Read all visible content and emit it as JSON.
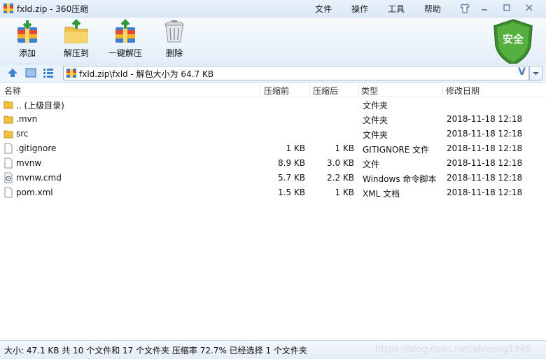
{
  "window": {
    "title": "fxld.zip - 360压缩",
    "menu": [
      "文件",
      "操作",
      "工具",
      "帮助"
    ]
  },
  "toolbar": {
    "items": [
      {
        "label": "添加",
        "icon": "add-archive-icon"
      },
      {
        "label": "解压到",
        "icon": "extract-to-folder-icon"
      },
      {
        "label": "一键解压",
        "icon": "one-click-extract-icon"
      },
      {
        "label": "删除",
        "icon": "trash-can-icon"
      }
    ],
    "safe_label": "安全"
  },
  "address": {
    "path": "fxld.zip\\fxld - 解包大小为 64.7 KB",
    "v_label": "V"
  },
  "columns": [
    "名称",
    "压缩前",
    "压缩后",
    "类型",
    "修改日期"
  ],
  "files": [
    {
      "name": ".. (上级目录)",
      "before": "",
      "after": "",
      "type": "文件夹",
      "date": "",
      "icon": "folder-icon"
    },
    {
      "name": ".mvn",
      "before": "",
      "after": "",
      "type": "文件夹",
      "date": "2018-11-18 12:18",
      "icon": "folder-icon"
    },
    {
      "name": "src",
      "before": "",
      "after": "",
      "type": "文件夹",
      "date": "2018-11-18 12:18",
      "icon": "folder-icon"
    },
    {
      "name": ".gitignore",
      "before": "1 KB",
      "after": "1 KB",
      "type": "GITIGNORE 文件",
      "date": "2018-11-18 12:18",
      "icon": "file-icon"
    },
    {
      "name": "mvnw",
      "before": "8.9 KB",
      "after": "3.0 KB",
      "type": "文件",
      "date": "2018-11-18 12:18",
      "icon": "file-icon"
    },
    {
      "name": "mvnw.cmd",
      "before": "5.7 KB",
      "after": "2.2 KB",
      "type": "Windows 命令脚本",
      "date": "2018-11-18 12:18",
      "icon": "script-file-icon"
    },
    {
      "name": "pom.xml",
      "before": "1.5 KB",
      "after": "1 KB",
      "type": "XML 文档",
      "date": "2018-11-18 12:18",
      "icon": "file-icon"
    }
  ],
  "status": {
    "text": "大小: 47.1 KB 共 10 个文件和 17 个文件夹 压缩率 72.7% 已经选择 1 个文件夹",
    "watermark": "https://blog.csdn.net/shiyong1949"
  }
}
